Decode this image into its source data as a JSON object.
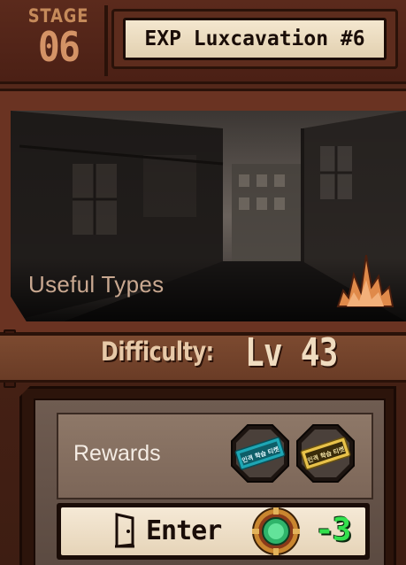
{
  "header": {
    "stage_label": "STAGE",
    "stage_number": "06",
    "title": "EXP Luxcavation #6"
  },
  "banner": {
    "useful_types_label": "Useful Types",
    "useful_type_icon": "burn-flame-icon"
  },
  "difficulty": {
    "label": "Difficulty:",
    "value": "Lv 43"
  },
  "rewards": {
    "label": "Rewards",
    "items": [
      {
        "icon": "exp-ticket-blue-icon",
        "text": "인격 학습 티켓"
      },
      {
        "icon": "exp-ticket-gold-icon",
        "text": "인격 학습 티켓"
      }
    ]
  },
  "enter": {
    "icon": "door-icon",
    "label": "Enter",
    "cost_icon": "enkephalin-module-icon",
    "cost": "-3"
  },
  "colors": {
    "frame_brown": "#5a2c1c",
    "plate_cream": "#f4e7cf",
    "cost_green": "#33e04d",
    "flame_orange": "#e08a4a"
  }
}
